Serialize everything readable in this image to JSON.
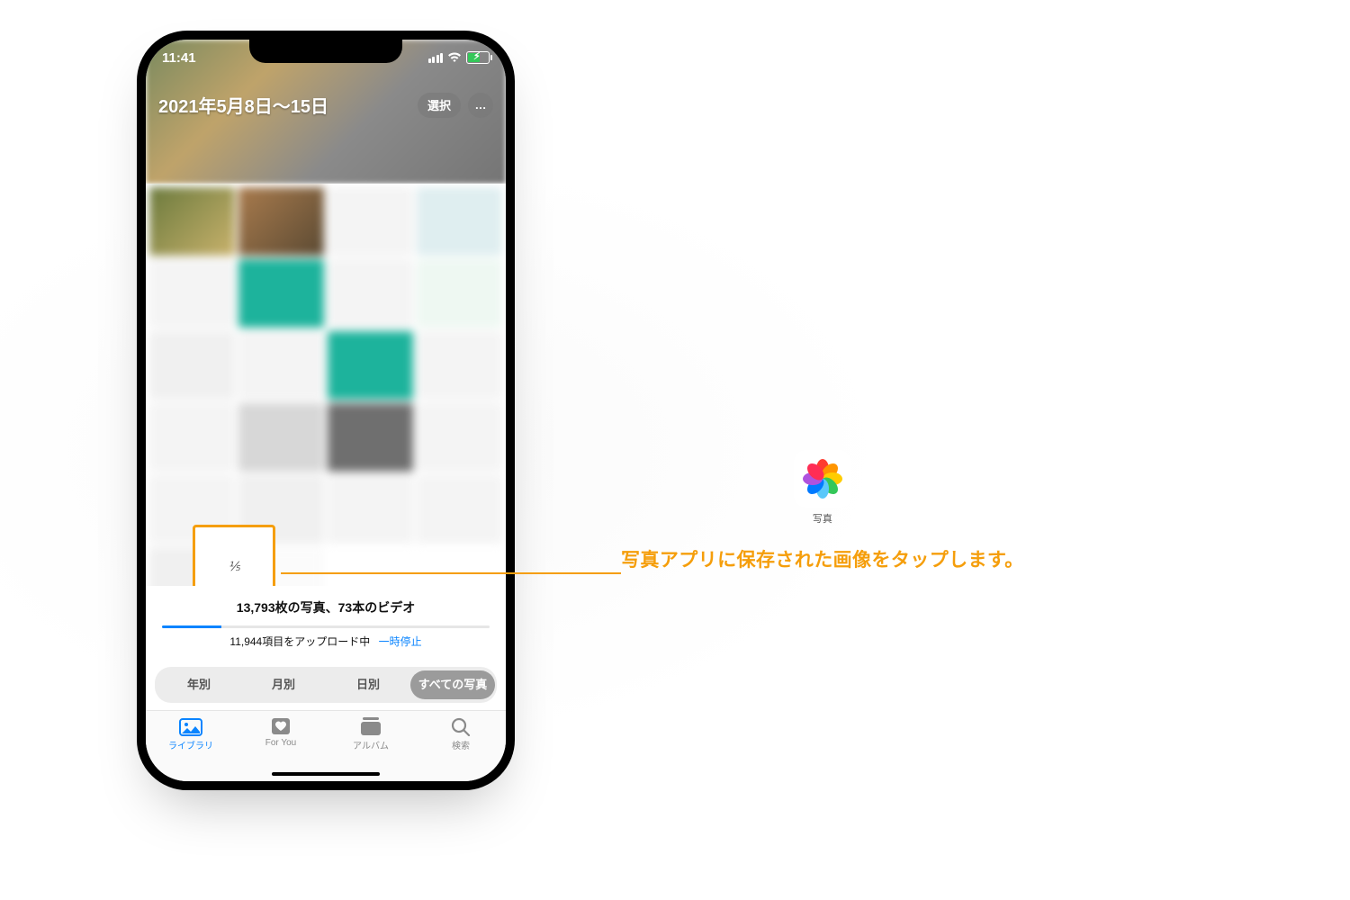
{
  "status": {
    "time": "11:41"
  },
  "header": {
    "title": "2021年5月8日〜15日",
    "select_label": "選択",
    "more_label": "…"
  },
  "highlight_thumb_text": "⅕",
  "summary": {
    "text": "13,793枚の写真、73本のビデオ"
  },
  "upload": {
    "status": "11,944項目をアップロード中",
    "pause": "一時停止"
  },
  "segments": {
    "year": "年別",
    "month": "月別",
    "day": "日別",
    "all": "すべての写真"
  },
  "tabs": {
    "library": "ライブラリ",
    "for_you": "For You",
    "albums": "アルバム",
    "search": "検索"
  },
  "callout": {
    "app_label": "写真",
    "text": "写真アプリに保存された画像をタップします。"
  },
  "colors": {
    "accent": "#f59e0b",
    "ios_blue": "#0a84ff"
  }
}
